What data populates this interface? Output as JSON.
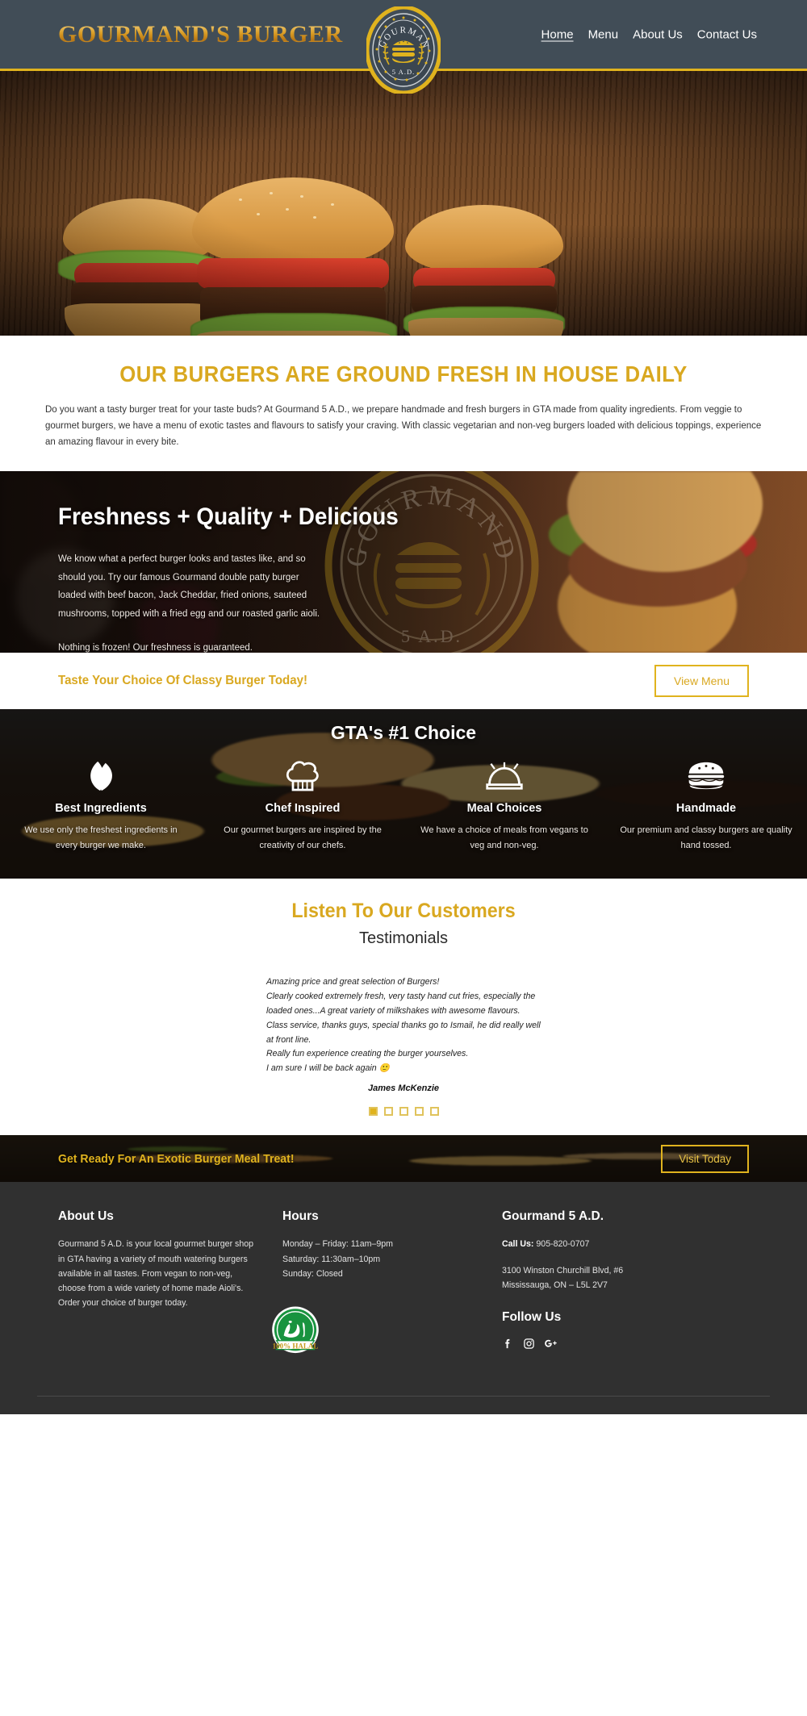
{
  "header": {
    "wordmark": "GOURMAND'S BURGER",
    "logo": {
      "arc_text": "GOURMAND",
      "bottom_text": "5 A.D.",
      "icon": "burger-badge-icon"
    },
    "nav": [
      {
        "label": "Home",
        "active": true
      },
      {
        "label": "Menu",
        "active": false
      },
      {
        "label": "About Us",
        "active": false
      },
      {
        "label": "Contact Us",
        "active": false
      }
    ]
  },
  "intro": {
    "heading": "OUR BURGERS ARE GROUND FRESH IN HOUSE DAILY",
    "body": "Do you want a tasty burger treat for your taste buds? At Gourmand 5 A.D., we prepare handmade and fresh burgers in GTA made from quality ingredients. From veggie to gourmet burgers, we have a menu of exotic tastes and flavours to satisfy your craving. With classic vegetarian and non-veg burgers loaded with delicious toppings, experience an amazing flavour in every bite."
  },
  "freshness": {
    "heading": "Freshness + Quality + Delicious",
    "body": "We know what a perfect burger looks and tastes like, and so should you. Try our famous Gourmand double patty burger loaded with beef bacon, Jack Cheddar, fried onions, sauteed mushrooms, topped with a fried egg and our roasted garlic aioli.",
    "tail": "Nothing is frozen! Our freshness is guaranteed."
  },
  "cta_top": {
    "text": "Taste Your Choice Of Classy Burger Today!",
    "button": "View Menu"
  },
  "features": {
    "title": "GTA's #1 Choice",
    "items": [
      {
        "icon": "leaf-icon",
        "name": "Best Ingredients",
        "desc": "We use only the freshest ingredients in every burger we make."
      },
      {
        "icon": "chef-hat-icon",
        "name": "Chef Inspired",
        "desc": "Our gourmet burgers are inspired by the creativity of our chefs."
      },
      {
        "icon": "cloche-icon",
        "name": "Meal Choices",
        "desc": "We have a choice of meals from vegans to veg and non-veg."
      },
      {
        "icon": "burger-icon",
        "name": "Handmade",
        "desc": "Our premium and classy burgers are quality hand tossed."
      }
    ]
  },
  "testimonials": {
    "heading": "Listen To Our Customers",
    "subheading": "Testimonials",
    "quote_lines": [
      "Amazing price and great selection of Burgers!",
      "Clearly cooked extremely fresh, very tasty hand cut fries, especially the loaded ones...A great variety of milkshakes with awesome flavours.",
      "Class service, thanks guys, special thanks go to Ismail, he did really well at front line.",
      "Really fun experience creating the burger yourselves.",
      "I am sure I will be back again 🙂"
    ],
    "author": "James McKenzie",
    "dot_count": 5,
    "active_dot": 0
  },
  "cta_bottom": {
    "text": "Get Ready For An Exotic Burger Meal Treat!",
    "button": "Visit Today"
  },
  "footer": {
    "about": {
      "title": "About Us",
      "body": "Gourmand 5 A.D. is your local gourmet burger shop in GTA having a variety of mouth watering burgers available in all tastes. From vegan to non-veg, choose from a wide variety of home made Aioli's. Order your choice of burger today."
    },
    "hours": {
      "title": "Hours",
      "lines": [
        "Monday – Friday: 11am–9pm",
        "Saturday: 11:30am–10pm",
        "Sunday: Closed"
      ]
    },
    "contact": {
      "title": "Gourmand 5 A.D.",
      "call_label": "Call Us:",
      "phone": "905-820-0707",
      "address_line1": "3100 Winston Churchill Blvd, #6",
      "address_line2": "Mississauga, ON – L5L 2V7",
      "follow_title": "Follow Us",
      "socials": [
        "facebook-icon",
        "instagram-icon",
        "google-plus-icon"
      ]
    },
    "halal_badge": {
      "script": "حلال",
      "ribbon": "100% HALAL"
    }
  },
  "colors": {
    "header_bg": "#414d57",
    "gold": "#e0b31e",
    "gold_text": "#d9a820",
    "footer_bg": "#303030",
    "halal_green": "#18933f"
  }
}
